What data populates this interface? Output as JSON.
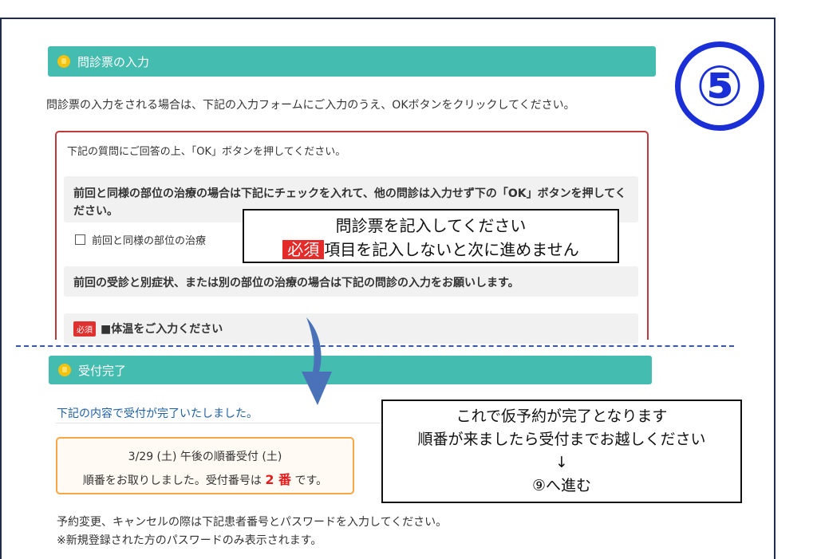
{
  "section1": {
    "title": "問診票の入力",
    "intro": "問診票の入力をされる場合は、下記の入力フォームにご入力のうえ、OKボタンをクリックしてください。",
    "form_intro": "下記の質問にご回答の上、「OK」ボタンを押してください。",
    "notice1": "前回と同様の部位の治療の場合は下記にチェックを入れて、他の問診は入力せず下の「OK」ボタンを押してください。",
    "checkbox_label": "前回と同様の部位の治療",
    "notice2": "前回の受診と別症状、または別の部位の治療の場合は下記の問診の入力をお願いします。",
    "required_badge": "必須",
    "question1": "■体温をご入力ください"
  },
  "callout1": {
    "line1": "問診票を記入してください",
    "required": "必須",
    "line2": "項目を記入しないと次に進めません"
  },
  "step_badge": "⑤",
  "section2": {
    "title": "受付完了",
    "done_text": "下記の内容で受付が完了いたしました。",
    "reservation_line": "3/29 (土) 午後の順番受付 (土)",
    "number_prefix": "順番をお取りしました。受付番号は",
    "number": "2 番",
    "number_suffix": "です。",
    "note1": "予約変更、キャンセルの際は下記患者番号とパスワードを入力してください。",
    "note2": "※新規登録された方のパスワードのみ表示されます。"
  },
  "callout2": {
    "line1": "これで仮予約が完了となります",
    "line2": "順番が来ましたら受付までお越しください",
    "arrow": "↓",
    "line3": "⑨へ進む"
  },
  "colors": {
    "teal": "#45bcb0",
    "red": "#c0393b",
    "blue": "#1a2fd6",
    "orange": "#f5a843",
    "arrow": "#4a72b8"
  }
}
